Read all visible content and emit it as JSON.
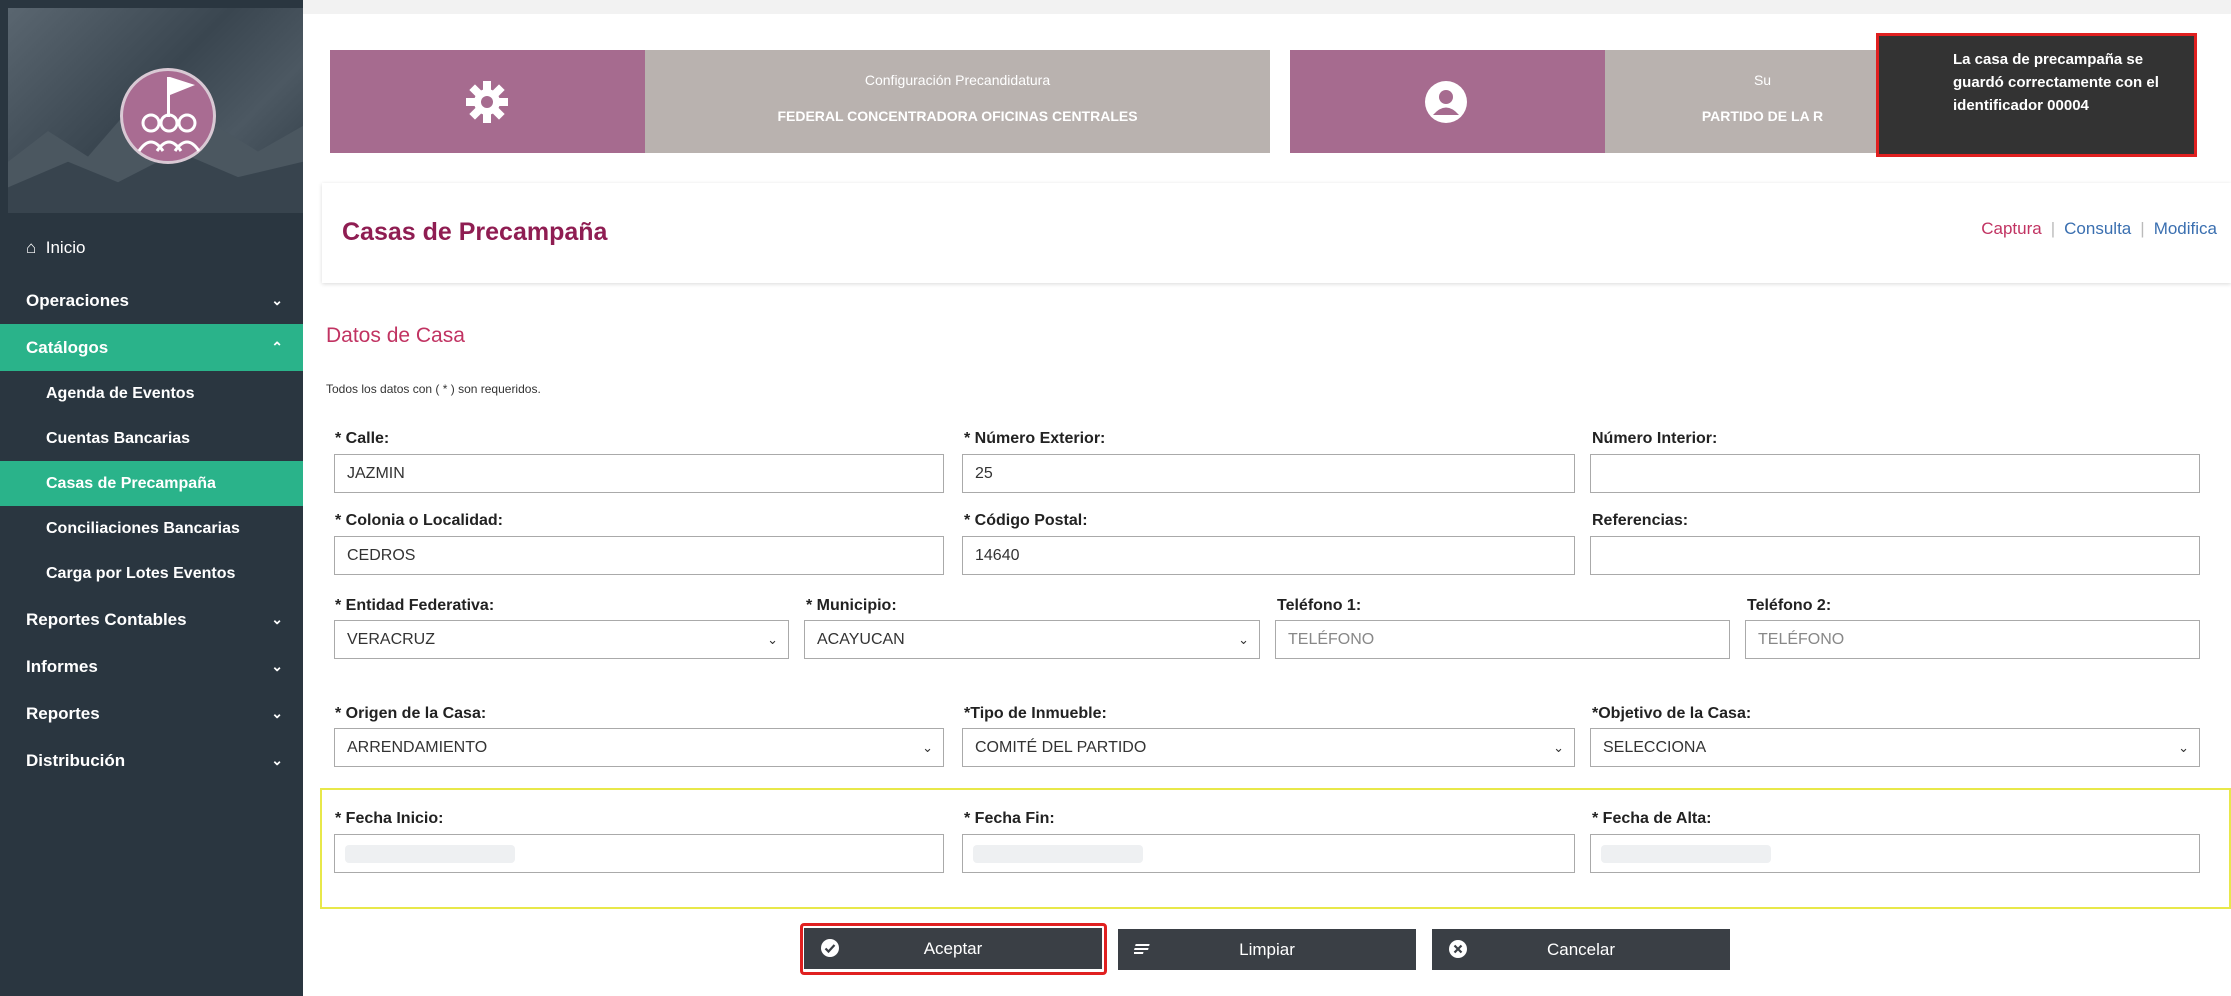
{
  "sidebar": {
    "items": [
      {
        "label": "Inicio"
      },
      {
        "label": "Operaciones"
      },
      {
        "label": "Catálogos"
      },
      {
        "label": "Reportes Contables"
      },
      {
        "label": "Informes"
      },
      {
        "label": "Reportes"
      },
      {
        "label": "Distribución"
      }
    ],
    "catalogos_sub": [
      {
        "label": "Agenda de Eventos"
      },
      {
        "label": "Cuentas Bancarias"
      },
      {
        "label": "Casas de Precampaña"
      },
      {
        "label": "Conciliaciones Bancarias"
      },
      {
        "label": "Carga por Lotes Eventos"
      }
    ],
    "active_color": "#2ab38a"
  },
  "cards": {
    "config": {
      "title": "Configuración Precandidatura",
      "value": "FEDERAL CONCENTRADORA OFICINAS CENTRALES",
      "icon": "gear-icon"
    },
    "subject": {
      "title": "Su",
      "value": "PARTIDO DE LA R",
      "icon": "user-icon"
    }
  },
  "toast": {
    "message": "La casa de precampaña se guardó correctamente con el identificador 00004"
  },
  "header": {
    "title": "Casas de Precampaña",
    "links": {
      "captura": "Captura",
      "consulta": "Consulta",
      "modifica": "Modifica"
    }
  },
  "form": {
    "section_title": "Datos de Casa",
    "required_note": "Todos los datos con ( * ) son requeridos.",
    "calle": {
      "label": "* Calle:",
      "value": "JAZMIN"
    },
    "numero_exterior": {
      "label": "* Número Exterior:",
      "value": "25"
    },
    "numero_interior": {
      "label": "Número Interior:",
      "value": ""
    },
    "colonia": {
      "label": "* Colonia o Localidad:",
      "value": "CEDROS"
    },
    "codigo_postal": {
      "label": "* Código Postal:",
      "value": "14640"
    },
    "referencias": {
      "label": "Referencias:",
      "value": ""
    },
    "entidad": {
      "label": "* Entidad Federativa:",
      "value": "VERACRUZ"
    },
    "municipio": {
      "label": "* Municipio:",
      "value": "ACAYUCAN"
    },
    "telefono1": {
      "label": "Teléfono 1:",
      "placeholder": "TELÉFONO"
    },
    "telefono2": {
      "label": "Teléfono 2:",
      "placeholder": "TELÉFONO"
    },
    "origen": {
      "label": "* Origen de la Casa:",
      "value": "ARRENDAMIENTO"
    },
    "tipo_inmueble": {
      "label": "*Tipo de Inmueble:",
      "value": "COMITÉ DEL PARTIDO"
    },
    "objetivo": {
      "label": "*Objetivo de la Casa:",
      "value": "SELECCIONA"
    },
    "fecha_inicio": {
      "label": "* Fecha Inicio:"
    },
    "fecha_fin": {
      "label": "* Fecha Fin:"
    },
    "fecha_alta": {
      "label": "* Fecha de Alta:"
    }
  },
  "buttons": {
    "aceptar": "Aceptar",
    "limpiar": "Limpiar",
    "cancelar": "Cancelar"
  },
  "colors": {
    "brand": "#8f1d52",
    "accent_pink": "#c13362",
    "card_purple": "#a66b8f",
    "highlight_red": "#e02020"
  }
}
